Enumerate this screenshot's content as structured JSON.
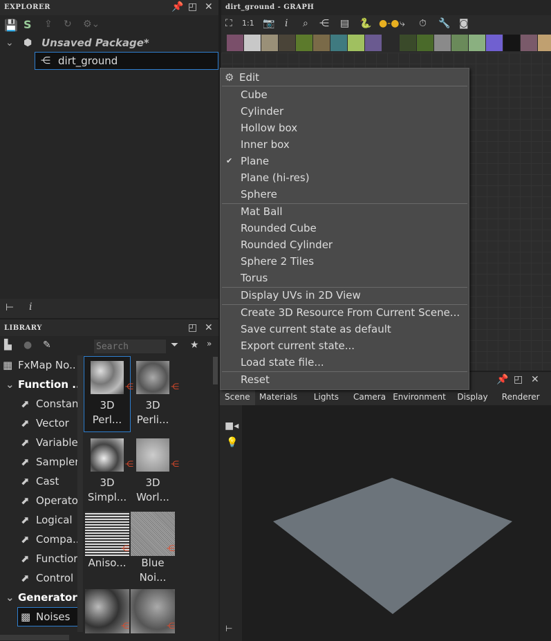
{
  "explorer": {
    "title": "EXPLORER",
    "package": "Unsaved Package*",
    "graph": "dirt_ground"
  },
  "graph": {
    "title": "dirt_ground - GRAPH"
  },
  "library": {
    "title": "LIBRARY",
    "search_placeholder": "Search",
    "tree": [
      {
        "label": "FxMap No..",
        "type": "item"
      },
      {
        "label": "Function ...",
        "type": "group"
      },
      {
        "label": "Constan",
        "type": "child"
      },
      {
        "label": "Vector",
        "type": "child"
      },
      {
        "label": "Variable",
        "type": "child"
      },
      {
        "label": "Sampler",
        "type": "child"
      },
      {
        "label": "Cast",
        "type": "child"
      },
      {
        "label": "Operato",
        "type": "child"
      },
      {
        "label": "Logical",
        "type": "child"
      },
      {
        "label": "Compa...",
        "type": "child"
      },
      {
        "label": "Functior",
        "type": "child"
      },
      {
        "label": "Control",
        "type": "child"
      },
      {
        "label": "Generators",
        "type": "group"
      },
      {
        "label": "Noises",
        "type": "selected"
      }
    ],
    "tiles": [
      {
        "line1": "3D",
        "line2": "Perl..."
      },
      {
        "line1": "3D",
        "line2": "Perli..."
      },
      {
        "line1": "3D",
        "line2": "Simpl..."
      },
      {
        "line1": "3D",
        "line2": "Worl..."
      },
      {
        "line1": "Aniso...",
        "line2": ""
      },
      {
        "line1": "Blue",
        "line2": "Noi..."
      },
      {
        "line1": "",
        "line2": ""
      },
      {
        "line1": "",
        "line2": ""
      }
    ]
  },
  "menu": {
    "header": "Edit",
    "items": [
      {
        "label": "Cube"
      },
      {
        "label": "Cylinder"
      },
      {
        "label": "Hollow box"
      },
      {
        "label": "Inner box"
      },
      {
        "label": "Plane",
        "checked": true
      },
      {
        "label": "Plane (hi-res)"
      },
      {
        "label": "Sphere"
      },
      {
        "label": "Mat Ball"
      },
      {
        "label": "Rounded Cube"
      },
      {
        "label": "Rounded Cylinder"
      },
      {
        "label": "Sphere 2 Tiles"
      },
      {
        "label": "Torus"
      },
      {
        "label": "Display UVs in 2D View"
      },
      {
        "label": "Create 3D Resource From Current Scene..."
      },
      {
        "label": "Save current state as default"
      },
      {
        "label": "Export current state..."
      },
      {
        "label": "Load state file..."
      },
      {
        "label": "Reset"
      }
    ]
  },
  "view3d": {
    "tabs": [
      "Scene",
      "Materials",
      "Lights",
      "Camera",
      "Environment",
      "Display",
      "Renderer"
    ],
    "active_tab": "Scene"
  },
  "node_colors": [
    "#7a4f6a",
    "#c8c8c8",
    "#9a9078",
    "#4a4438",
    "#5c7a2c",
    "#7a6a48",
    "#3f7a80",
    "#a0c060",
    "#6a5a90",
    "#2a2a2a",
    "#3a4a2a",
    "#4a6a2a",
    "#8a8a8a",
    "#6a8a5a",
    "#8ab080",
    "#7060d0",
    "#151515",
    "#7a5a6a",
    "#c0a070"
  ]
}
